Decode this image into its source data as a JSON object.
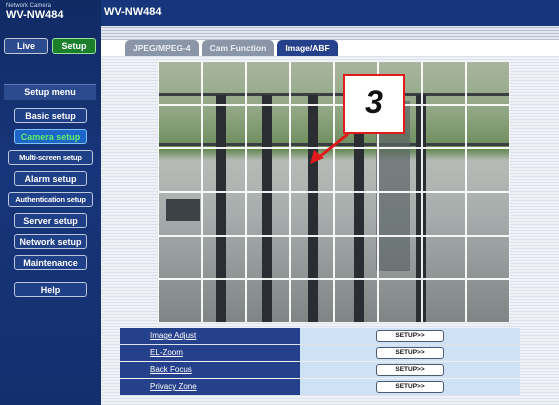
{
  "brand": {
    "small": "Network Camera",
    "model": "WV-NW484"
  },
  "header": {
    "title": "WV-NW484"
  },
  "modes": {
    "live": "Live",
    "setup": "Setup"
  },
  "sidebar": {
    "title": "Setup menu",
    "items": [
      {
        "label": "Basic setup",
        "active": false
      },
      {
        "label": "Camera setup",
        "active": true
      },
      {
        "label": "Multi-screen setup",
        "active": false
      },
      {
        "label": "Alarm setup",
        "active": false
      },
      {
        "label": "Authentication setup",
        "active": false
      },
      {
        "label": "Server setup",
        "active": false
      },
      {
        "label": "Network setup",
        "active": false
      },
      {
        "label": "Maintenance",
        "active": false
      }
    ],
    "help": "Help"
  },
  "tabs": [
    {
      "label": "JPEG/MPEG-4",
      "active": false
    },
    {
      "label": "Cam Function",
      "active": false
    },
    {
      "label": "Image/ABF",
      "active": true
    }
  ],
  "camera": {
    "grid_cols": 8,
    "grid_rows": 6
  },
  "callout": {
    "number": "3",
    "color": "#e11b1b"
  },
  "settings": [
    {
      "label": "Image Adjust",
      "button": "SETUP>>"
    },
    {
      "label": "EL-Zoom",
      "button": "SETUP>>"
    },
    {
      "label": "Back Focus",
      "button": "SETUP>>"
    },
    {
      "label": "Privacy Zone",
      "button": "SETUP>>"
    }
  ],
  "colors": {
    "navy": "#17357a",
    "active_green": "#5ef06a",
    "setup_green": "#1a7e2a"
  }
}
